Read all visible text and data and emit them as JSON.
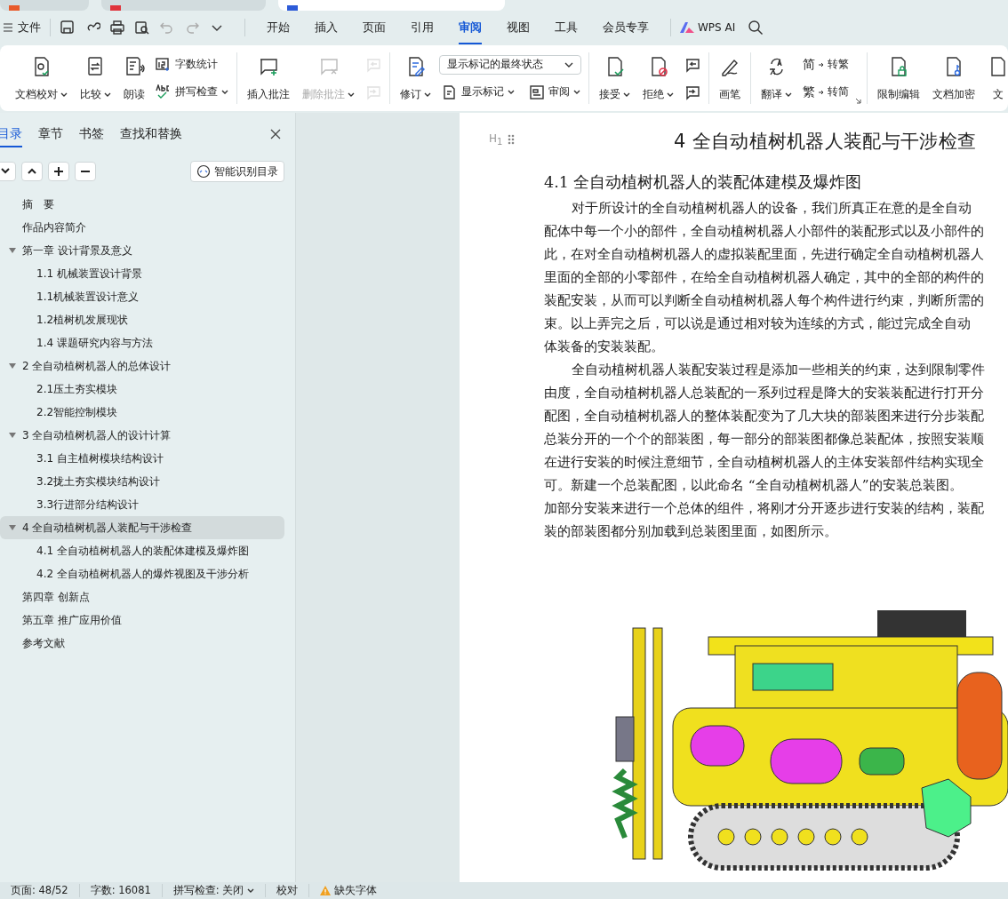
{
  "window_tabs": [
    {
      "selected": false
    },
    {
      "selected": false
    },
    {
      "selected": true
    }
  ],
  "menu_bar": {
    "file": "文件",
    "tabs": [
      {
        "label": "开始",
        "selected": false
      },
      {
        "label": "插入",
        "selected": false
      },
      {
        "label": "页面",
        "selected": false
      },
      {
        "label": "引用",
        "selected": false
      },
      {
        "label": "审阅",
        "selected": true
      },
      {
        "label": "视图",
        "selected": false
      },
      {
        "label": "工具",
        "selected": false
      },
      {
        "label": "会员专享",
        "selected": false
      }
    ],
    "ai": "WPS AI"
  },
  "ribbon": {
    "groups": [
      {
        "items": [
          {
            "kind": "big",
            "label": "文档校对",
            "dropdown": true,
            "disabled": false
          },
          {
            "kind": "big",
            "label": "比较",
            "dropdown": true,
            "disabled": false
          },
          {
            "kind": "big",
            "label": "朗读",
            "dropdown": false,
            "disabled": false
          },
          {
            "kind": "stack",
            "items": [
              {
                "label": "字数统计",
                "dropdown": false,
                "disabled": false
              },
              {
                "label": "拼写检查",
                "dropdown": true,
                "disabled": false
              }
            ]
          }
        ]
      },
      {
        "items": [
          {
            "kind": "big",
            "label": "插入批注",
            "dropdown": false,
            "disabled": false
          },
          {
            "kind": "big",
            "label": "删除批注",
            "dropdown": true,
            "disabled": true
          },
          {
            "kind": "stack",
            "items": [
              {
                "dropdown": false,
                "disabled": true
              },
              {
                "dropdown": false,
                "disabled": true
              }
            ]
          }
        ]
      },
      {
        "items": [
          {
            "kind": "big",
            "label": "修订",
            "dropdown": true,
            "disabled": false
          },
          {
            "kind": "combo",
            "value": "显示标记的最终状态",
            "items": [
              {
                "label": "显示标记",
                "dropdown": true,
                "disabled": false
              },
              {
                "label": "审阅",
                "dropdown": true,
                "disabled": false
              }
            ]
          }
        ]
      },
      {
        "items": [
          {
            "kind": "big",
            "label": "接受",
            "dropdown": true,
            "disabled": false
          },
          {
            "kind": "big",
            "label": "拒绝",
            "dropdown": true,
            "disabled": false
          },
          {
            "kind": "stack",
            "items": [
              {
                "dropdown": false,
                "disabled": false
              },
              {
                "dropdown": false,
                "disabled": false
              }
            ]
          }
        ]
      },
      {
        "items": [
          {
            "kind": "big",
            "label": "画笔",
            "dropdown": false,
            "disabled": false
          }
        ]
      },
      {
        "items": [
          {
            "kind": "big",
            "label": "翻译",
            "dropdown": true,
            "disabled": false
          },
          {
            "kind": "stack",
            "items": [
              {
                "glyph": "简",
                "label": "转繁",
                "dropdown": false,
                "disabled": false
              },
              {
                "glyph": "繁",
                "label": "转简",
                "dropdown": false,
                "disabled": false
              }
            ]
          }
        ]
      },
      {
        "items": [
          {
            "kind": "big",
            "label": "限制编辑",
            "dropdown": false,
            "disabled": false
          },
          {
            "kind": "big",
            "label": "文档加密",
            "dropdown": false,
            "disabled": false
          },
          {
            "kind": "big",
            "label": "文",
            "dropdown": false,
            "disabled": false
          }
        ]
      }
    ]
  },
  "sidebar": {
    "tabs": [
      {
        "label": "目录",
        "selected": true
      },
      {
        "label": "章节",
        "selected": false
      },
      {
        "label": "书签",
        "selected": false
      },
      {
        "label": "查找和替换",
        "selected": false
      }
    ],
    "smart_button": "智能识别目录",
    "toc": [
      {
        "label": "摘　要",
        "selected": false
      },
      {
        "label": "作品内容简介",
        "selected": false
      },
      {
        "label": "第一章  设计背景及意义",
        "selected": false,
        "expanded": true,
        "children": [
          {
            "label": "1.1 机械装置设计背景",
            "selected": false
          },
          {
            "label": "1.1机械装置设计意义",
            "selected": false
          },
          {
            "label": "1.2植树机发展现状",
            "selected": false
          },
          {
            "label": "1.4 课题研究内容与方法",
            "selected": false
          }
        ]
      },
      {
        "label": "2 全自动植树机器人的总体设计",
        "selected": false,
        "expanded": true,
        "children": [
          {
            "label": "2.1压土夯实模块",
            "selected": false
          },
          {
            "label": "2.2智能控制模块",
            "selected": false
          }
        ]
      },
      {
        "label": "3 全自动植树机器人的设计计算",
        "selected": false,
        "expanded": true,
        "children": [
          {
            "label": "3.1 自主植树模块结构设计",
            "selected": false
          },
          {
            "label": "3.2拢土夯实模块结构设计",
            "selected": false
          },
          {
            "label": "3.3行进部分结构设计",
            "selected": false
          }
        ]
      },
      {
        "label": "4 全自动植树机器人装配与干涉检查",
        "selected": true,
        "expanded": true,
        "children": [
          {
            "label": "4.1  全自动植树机器人的装配体建模及爆炸图",
            "selected": false
          },
          {
            "label": "4.2 全自动植树机器人的爆炸视图及干涉分析",
            "selected": false
          }
        ]
      },
      {
        "label": "第四章  创新点",
        "selected": false
      },
      {
        "label": "第五章  推广应用价值",
        "selected": false
      },
      {
        "label": "参考文献",
        "selected": false
      }
    ]
  },
  "document": {
    "heading_marker": "H$_{1}$",
    "title": "4 全自动植树机器人装配与干涉检查",
    "subtitle": "4.1  全自动植树机器人的装配体建模及爆炸图",
    "paragraphs": [
      [
        "对于所设计的全自动植树机器人的设备，我们所真正在意的是全自动",
        "配体中每一个小的部件，全自动植树机器人小部件的装配形式以及小部件的",
        "此，在对全自动植树机器人的虚拟装配里面，先进行确定全自动植树机器人",
        "里面的全部的小零部件，在给全自动植树机器人确定，其中的全部的构件的",
        "装配安装，从而可以判断全自动植树机器人每个构件进行约束，判断所需的",
        "束。以上弄完之后，可以说是通过相对较为连续的方式，能过完成全自动",
        "体装备的安装装配。"
      ],
      [
        "全自动植树机器人装配安装过程是添加一些相关的约束，达到限制零件",
        "由度，全自动植树机器人总装配的一系列过程是降大的安装装配进行打开分",
        "配图，全自动植树机器人的整体装配变为了几大块的部装图来进行分步装配",
        "总装分开的一个个的部装图，每一部分的部装图都像总装配体，按照安装顺",
        "在进行安装的时候注意细节，全自动植树机器人的主体安装部件结构实现全",
        "可。新建一个总装配图，以此命名 “全自动植树机器人”的安装总装图。",
        "加部分安装来进行一个总体的组件，将刚才分开逐步进行安装的结构，装配",
        "装的部装图都分别加载到总装图里面，如图所示。"
      ]
    ]
  },
  "status_bar": {
    "page": "页面: 48/52",
    "words": "字数: 16081",
    "spell": "拼写检查: 关闭",
    "proof": "校对",
    "missing_font": "缺失字体"
  }
}
